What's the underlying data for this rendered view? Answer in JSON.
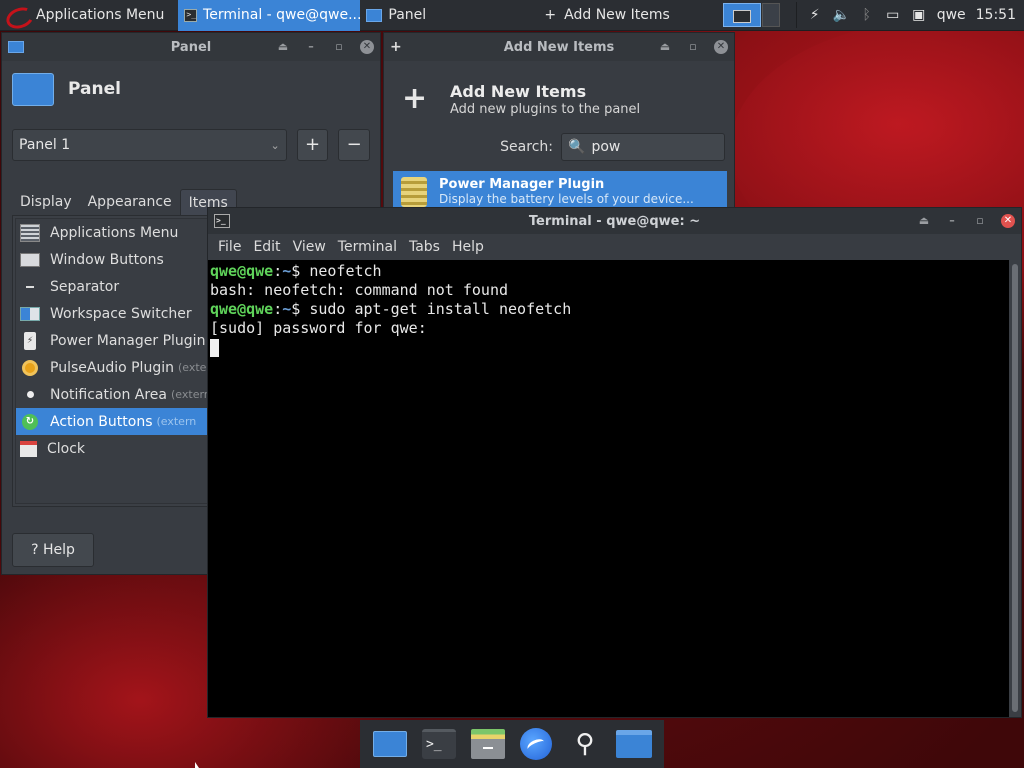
{
  "top_panel": {
    "apps_menu_label": "Applications Menu",
    "tasks": [
      {
        "label": "Terminal - qwe@qwe...",
        "active": true,
        "icon": "terminal-icon"
      },
      {
        "label": "Panel",
        "active": false,
        "icon": "panel-icon"
      },
      {
        "label": "Add New Items",
        "active": false,
        "icon": "plus-icon"
      }
    ],
    "tray": {
      "user": "qwe",
      "clock": "15:51",
      "icons": [
        "power-icon",
        "volume-icon",
        "bluetooth-icon",
        "network-icon",
        "notification-icon"
      ]
    }
  },
  "panel_window": {
    "title": "Panel",
    "heading": "Panel",
    "selected_panel": "Panel 1",
    "add_label": "+",
    "remove_label": "−",
    "tabs": [
      {
        "label": "Display",
        "active": false
      },
      {
        "label": "Appearance",
        "active": false
      },
      {
        "label": "Items",
        "active": true
      }
    ],
    "items": [
      {
        "label": "Applications Menu",
        "ext": "",
        "icon": "menu",
        "selected": false
      },
      {
        "label": "Window Buttons",
        "ext": "",
        "icon": "wb",
        "selected": false
      },
      {
        "label": "Separator",
        "ext": "",
        "icon": "sep",
        "selected": false
      },
      {
        "label": "Workspace Switcher",
        "ext": "",
        "icon": "ws",
        "selected": false
      },
      {
        "label": "Power Manager Plugin",
        "ext": "(",
        "icon": "pm",
        "selected": false
      },
      {
        "label": "PulseAudio Plugin",
        "ext": "(extern",
        "icon": "pa",
        "selected": false
      },
      {
        "label": "Notification Area",
        "ext": "(extern",
        "icon": "na",
        "selected": false
      },
      {
        "label": "Action Buttons",
        "ext": "(extern",
        "icon": "ab",
        "selected": true
      },
      {
        "label": "Clock",
        "ext": "",
        "icon": "clock",
        "selected": false
      }
    ],
    "help_label": "Help"
  },
  "add_window": {
    "title": "Add New Items",
    "heading": "Add New Items",
    "subheading": "Add new plugins to the panel",
    "search_label": "Search:",
    "search_value": "pow",
    "result": {
      "title": "Power Manager Plugin",
      "description": "Display the battery levels of your device..."
    }
  },
  "terminal": {
    "title": "Terminal - qwe@qwe: ~",
    "menu": [
      "File",
      "Edit",
      "View",
      "Terminal",
      "Tabs",
      "Help"
    ],
    "prompt_user": "qwe@qwe",
    "prompt_path": "~",
    "lines": [
      {
        "type": "cmd",
        "text": "neofetch"
      },
      {
        "type": "out",
        "text": "bash: neofetch: command not found"
      },
      {
        "type": "cmd",
        "text": "sudo apt-get install neofetch"
      },
      {
        "type": "out",
        "text": "[sudo] password for qwe:"
      }
    ]
  },
  "dock": {
    "items": [
      "desktop-icon",
      "terminal-icon",
      "file-manager-icon",
      "web-browser-icon",
      "app-finder-icon",
      "home-folder-icon"
    ]
  },
  "colors": {
    "accent": "#3b84d6",
    "prompt_user": "#5fd35a",
    "prompt_path": "#6c9fd6",
    "close_red": "#e0524f"
  }
}
